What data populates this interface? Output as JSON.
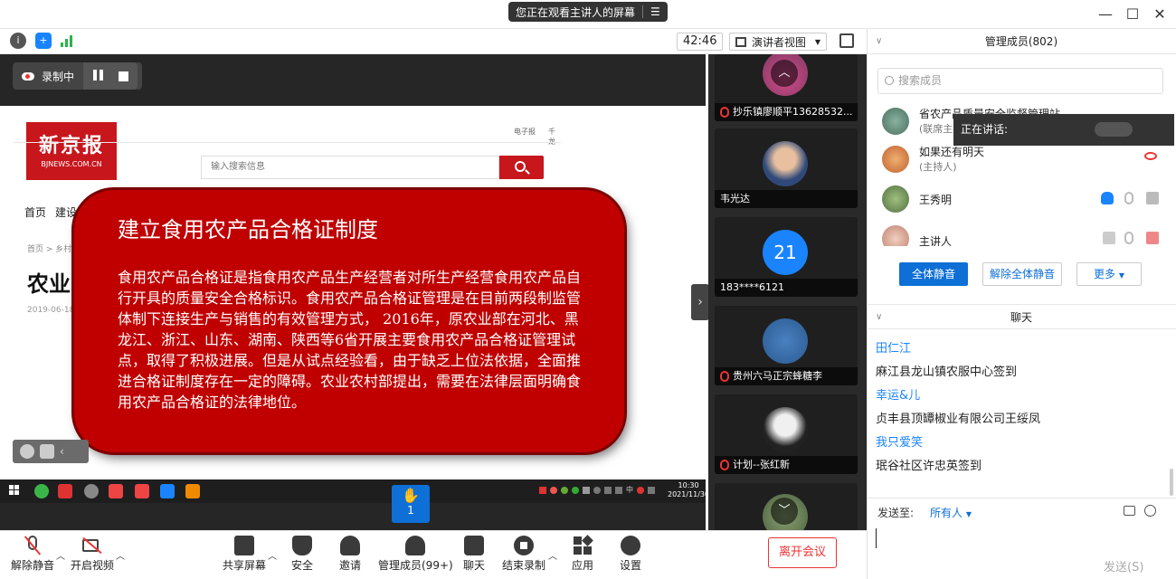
{
  "window": {
    "watching_banner": "您正在观看主讲人的屏幕",
    "timer": "42:46",
    "view_mode": "演讲者视图"
  },
  "recording": {
    "status": "录制中"
  },
  "newspaper": {
    "logo_main": "新京报",
    "logo_sub": "BJNEWS.COM.CN",
    "top_links": [
      "电子报",
      "千龙"
    ],
    "search_placeholder": "输入搜索信息",
    "nav": [
      "首页",
      "建设"
    ],
    "breadcrumb": "首页 > 乡村",
    "headline": "农业",
    "date": "2019-06-18"
  },
  "slide": {
    "title": "建立食用农产品合格证制度",
    "body": "食用农产品合格证是指食用农产品生产经营者对所生产经营食用农产品自行开具的质量安全合格标识。食用农产品合格证管理是在目前两段制监管体制下连接生产与销售的有效管理方式， 2016年，原农业部在河北、黑龙江、浙江、山东、湖南、陕西等6省开展主要食用农产品合格证管理试点，取得了积极进展。但是从试点经验看，由于缺乏上位法依据，全面推进合格证制度存在一定的障碍。农业农村部提出，需要在法律层面明确食用农产品合格证的法律地位。"
  },
  "taskbar": {
    "time": "10:30",
    "date": "2021/11/30",
    "tray_text": "中"
  },
  "raise_hand": {
    "count": "1"
  },
  "video_tiles": [
    {
      "name": "抄乐镇廖顺平13628532...",
      "muted": true
    },
    {
      "name": "韦光达",
      "muted": false
    },
    {
      "name": "183****6121",
      "muted": false,
      "avatar_text": "21"
    },
    {
      "name": "贵州六马正宗蜂糖李",
      "muted": true
    },
    {
      "name": "计划--张红新",
      "muted": true
    },
    {
      "name": "",
      "muted": false
    }
  ],
  "toolbar": {
    "unmute": "解除静音",
    "start_video": "开启视频",
    "share_screen": "共享屏幕",
    "security": "安全",
    "invite": "邀请",
    "members": "管理成员(99+)",
    "chat": "聊天",
    "end_recording": "结束录制",
    "apps": "应用",
    "settings": "设置",
    "leave": "离开会议"
  },
  "members_panel": {
    "header": "管理成员(802)",
    "search_placeholder": "搜索成员",
    "speaking_label": "正在讲话:",
    "members": [
      {
        "name": "省农产品质量安全监督管理站",
        "role": "(联席主持人)"
      },
      {
        "name": "如果还有明天",
        "role": "(主持人)"
      },
      {
        "name": "王秀明",
        "role": ""
      },
      {
        "name": "主讲人",
        "role": ""
      }
    ],
    "mute_all": "全体静音",
    "unmute_all": "解除全体静音",
    "more": "更多"
  },
  "chat_panel": {
    "header": "聊天",
    "messages": [
      {
        "sender": "田仁江",
        "text": "麻江县龙山镇农服中心签到"
      },
      {
        "sender": "幸运&儿",
        "text": "贞丰县顶罈椒业有限公司王绥凤"
      },
      {
        "sender": "我只爱笑",
        "text": "珉谷社区许忠英签到"
      }
    ],
    "send_to_label": "发送至:",
    "send_to_value": "所有人",
    "send_button": "发送(S)"
  },
  "colors": {
    "accent": "#0e6fd6",
    "slide_red": "#c00000",
    "leave_red": "#e33333"
  }
}
